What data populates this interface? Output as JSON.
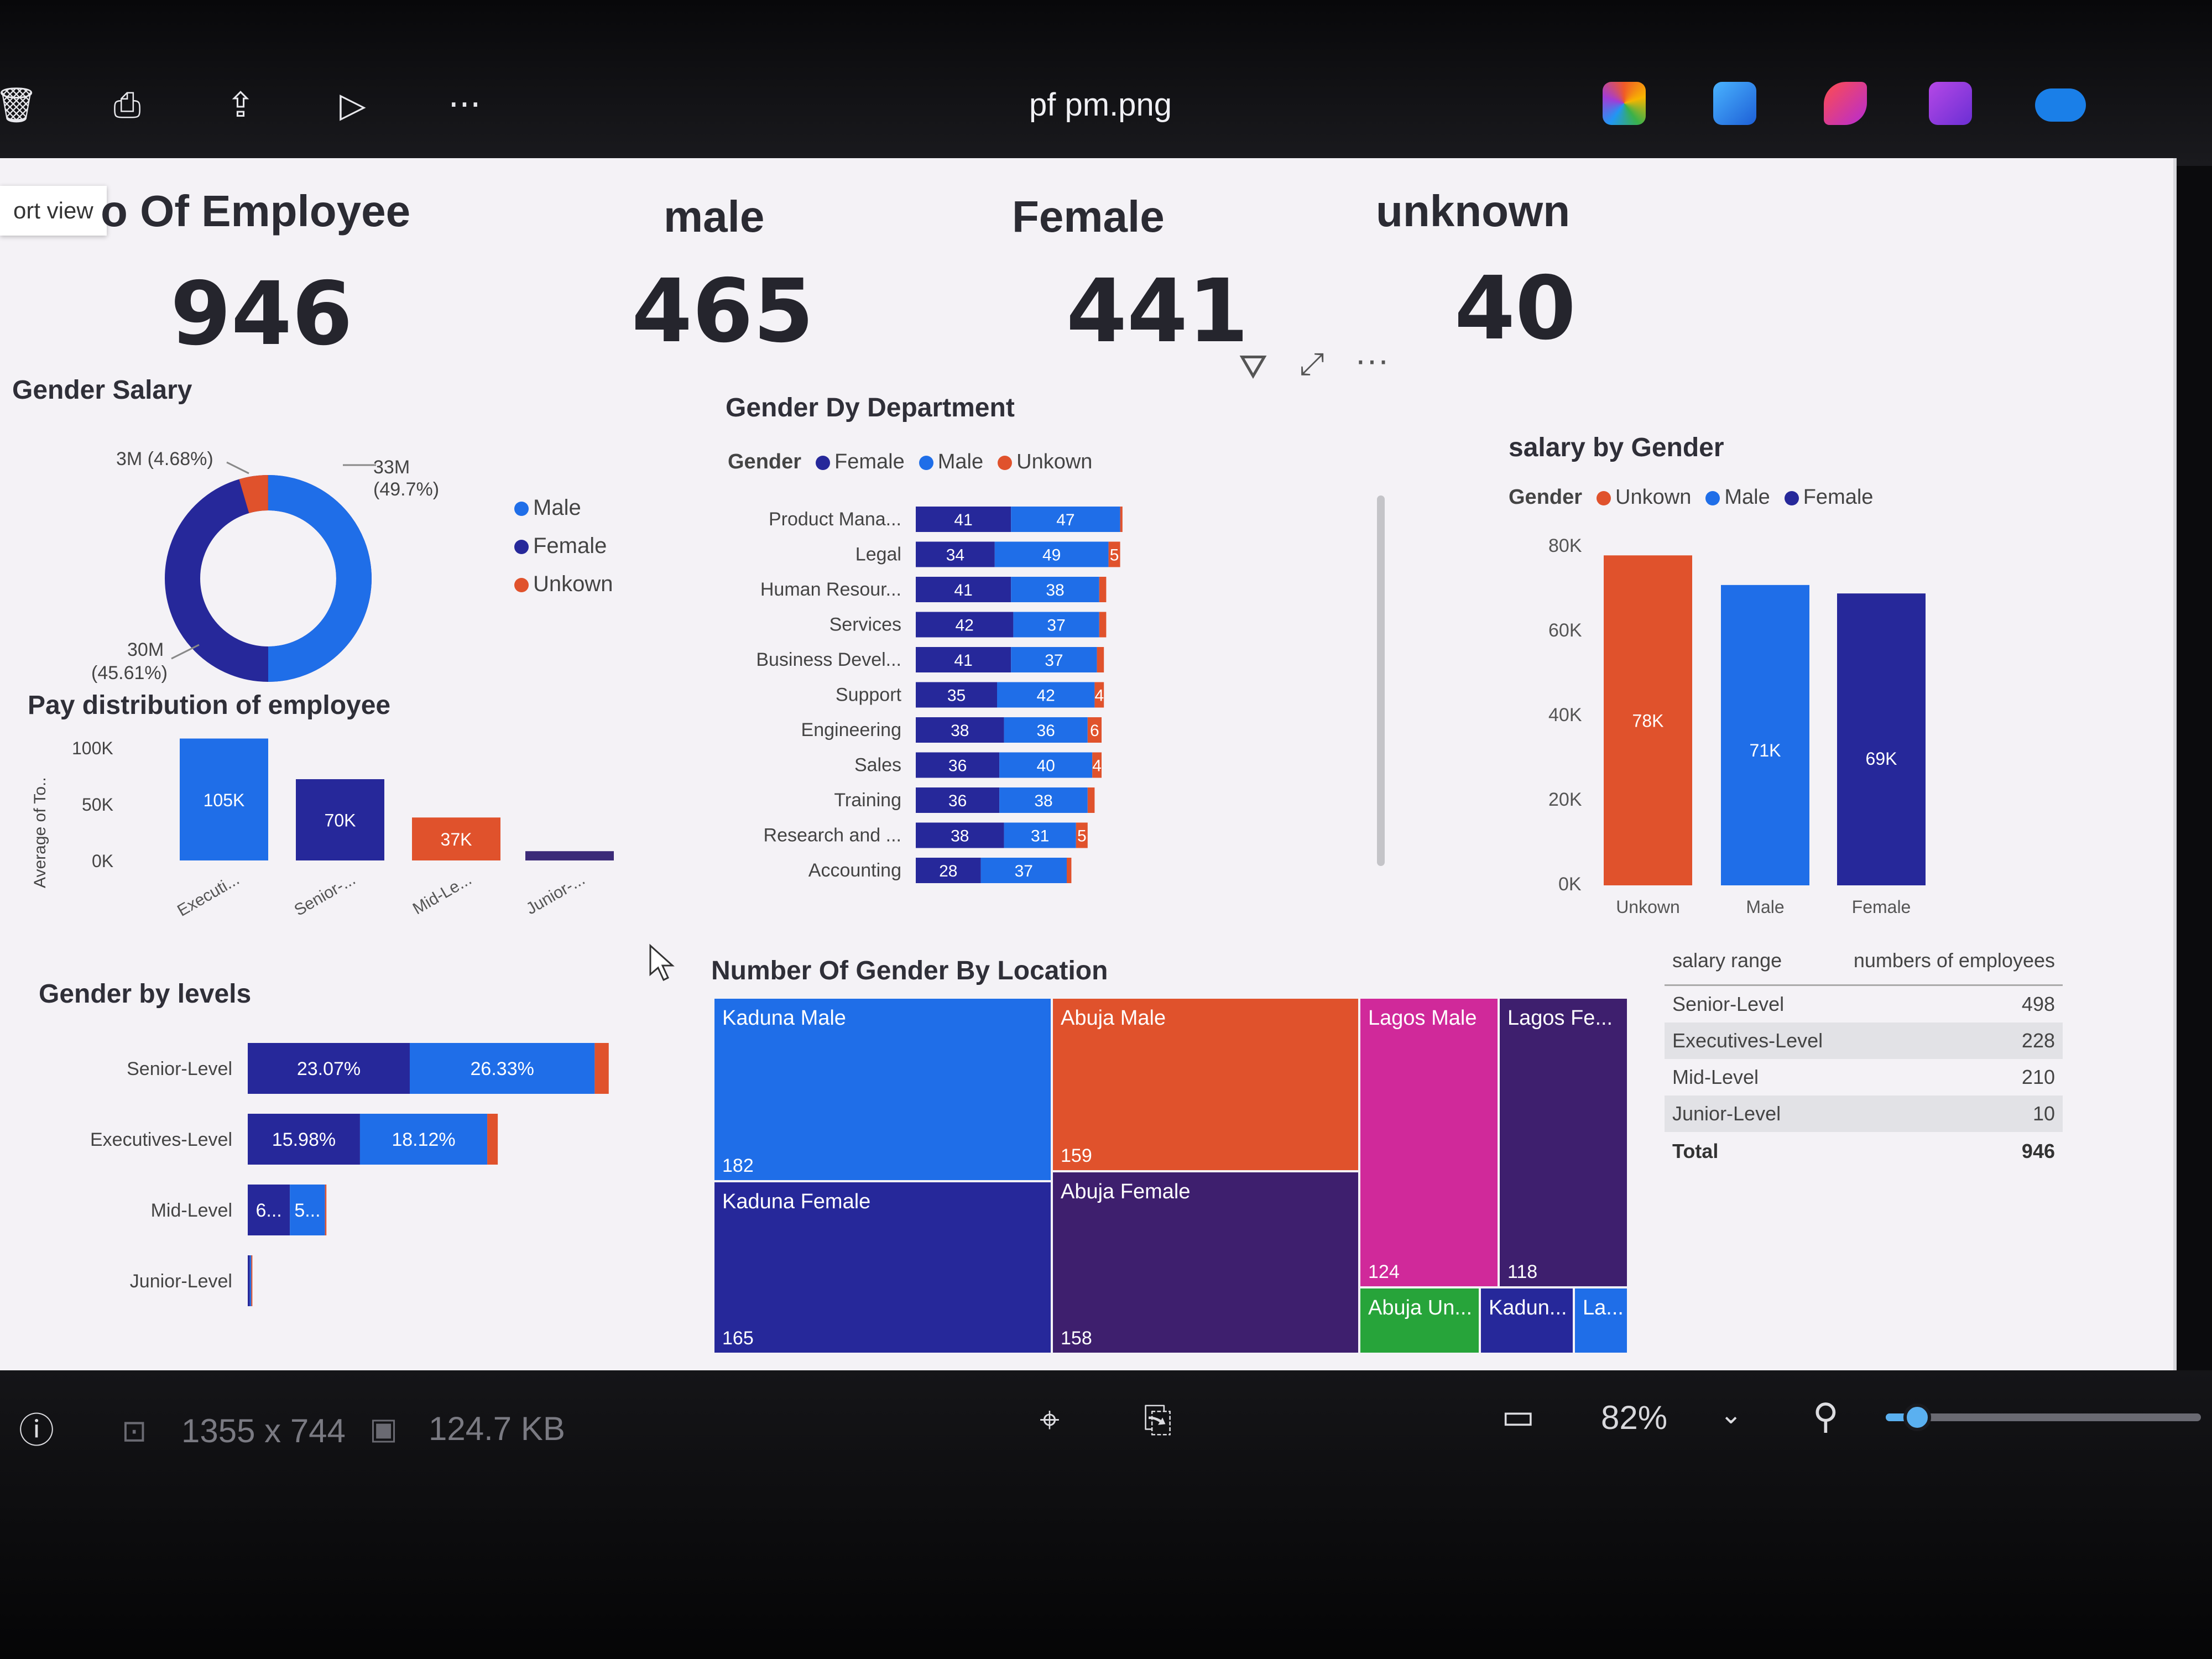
{
  "window": {
    "title": "pf pm.png",
    "toolbar_icons": [
      "delete-icon",
      "print-icon",
      "share-icon",
      "slideshow-icon",
      "more-icon"
    ],
    "app_icons": [
      "copilot-icon",
      "photos-icon",
      "clipchamp-icon",
      "designer-icon",
      "onedrive-icon"
    ]
  },
  "tooltip": {
    "text": "ort view"
  },
  "kpis": {
    "total": {
      "label": "o Of Employee",
      "value": "946"
    },
    "male": {
      "label": "male",
      "value": "465"
    },
    "female": {
      "label": "Female",
      "value": "441"
    },
    "unknown": {
      "label": "unknown",
      "value": "40"
    }
  },
  "visual_header_icons": [
    "filter-icon",
    "focus-mode-icon",
    "more-options-icon"
  ],
  "colors": {
    "male": "#1f6ee8",
    "female": "#26289a",
    "unknown": "#e0522c",
    "junior": "#3b2a78",
    "magenta": "#d0299a",
    "purple": "#3e1f6e",
    "green": "#27a43a"
  },
  "gender_salary": {
    "title": "Gender Salary",
    "labels": {
      "unknown": "3M (4.68%)",
      "male_top": "33M",
      "male_pct": "(49.7%)",
      "female_val": "30M",
      "female_pct": "(45.61%)"
    },
    "legend": [
      "Male",
      "Female",
      "Unkown"
    ]
  },
  "pay_distribution": {
    "title": "Pay distribution of employee",
    "y_title": "Average of To..",
    "y_ticks": [
      "100K",
      "50K",
      "0K"
    ]
  },
  "gender_by_department": {
    "title": "Gender Dy Department",
    "legend_title": "Gender",
    "legend": [
      "Female",
      "Male",
      "Unkown"
    ]
  },
  "salary_by_gender": {
    "title": "salary by Gender",
    "legend_title": "Gender",
    "legend": [
      "Unkown",
      "Male",
      "Female"
    ],
    "y_ticks": [
      "80K",
      "60K",
      "40K",
      "20K",
      "0K"
    ]
  },
  "gender_by_levels": {
    "title": "Gender by levels"
  },
  "location": {
    "title": "Number Of Gender By Location"
  },
  "salary_table": {
    "headers": [
      "salary range",
      "numbers of employees"
    ],
    "rows": [
      {
        "range": "Senior-Level",
        "count": "498"
      },
      {
        "range": "Executives-Level",
        "count": "228"
      },
      {
        "range": "Mid-Level",
        "count": "210"
      },
      {
        "range": "Junior-Level",
        "count": "10"
      }
    ],
    "total_label": "Total",
    "total_value": "946"
  },
  "status": {
    "dimensions": "1355 x 744",
    "file_size": "124.7 KB",
    "zoom": "82%",
    "zoom_level": 0.1
  },
  "chart_data": [
    {
      "type": "pie",
      "title": "Gender Salary",
      "categories": [
        "Male",
        "Female",
        "Unkown"
      ],
      "values": [
        33,
        30,
        3
      ],
      "percent": [
        49.7,
        45.61,
        4.68
      ],
      "unit": "M"
    },
    {
      "type": "bar",
      "title": "Pay distribution of employee",
      "ylabel": "Average of To..",
      "categories": [
        "Executi...",
        "Senior-...",
        "Mid-Le...",
        "Junior-..."
      ],
      "values": [
        105,
        70,
        37,
        8
      ],
      "labels": [
        "105K",
        "70K",
        "37K",
        ""
      ],
      "ylim": [
        0,
        100
      ]
    },
    {
      "type": "bar",
      "title": "Gender Dy Department",
      "categories": [
        "Product Mana...",
        "Legal",
        "Human Resour...",
        "Services",
        "Business Devel...",
        "Support",
        "Engineering",
        "Sales",
        "Training",
        "Research and ...",
        "Accounting"
      ],
      "series": [
        {
          "name": "Female",
          "values": [
            41,
            34,
            41,
            42,
            41,
            35,
            38,
            36,
            36,
            38,
            28
          ]
        },
        {
          "name": "Male",
          "values": [
            47,
            49,
            38,
            37,
            37,
            42,
            36,
            40,
            38,
            31,
            37
          ]
        },
        {
          "name": "Unkown",
          "values": [
            1,
            5,
            3,
            3,
            3,
            4,
            6,
            4,
            3,
            5,
            2
          ]
        }
      ]
    },
    {
      "type": "bar",
      "title": "salary by Gender",
      "categories": [
        "Unkown",
        "Male",
        "Female"
      ],
      "values": [
        78,
        71,
        69
      ],
      "labels": [
        "78K",
        "71K",
        "69K"
      ],
      "ylim": [
        0,
        80
      ]
    },
    {
      "type": "bar",
      "title": "Gender by levels",
      "categories": [
        "Senior-Level",
        "Executives-Level",
        "Mid-Level",
        "Junior-Level"
      ],
      "series": [
        {
          "name": "Female",
          "values": [
            23.07,
            15.98,
            6.0,
            0.3
          ],
          "labels": [
            "23.07%",
            "15.98%",
            "6...",
            ""
          ]
        },
        {
          "name": "Male",
          "values": [
            26.33,
            18.12,
            5.0,
            0.2
          ],
          "labels": [
            "26.33%",
            "18.12%",
            "5...",
            ""
          ]
        },
        {
          "name": "Unkown",
          "values": [
            2.0,
            1.5,
            0.2,
            0.1
          ],
          "labels": [
            "",
            "",
            "",
            ""
          ]
        }
      ]
    },
    {
      "type": "table",
      "title": "Number Of Gender By Location",
      "cells": [
        {
          "label": "Kaduna Male",
          "value": 182
        },
        {
          "label": "Kaduna Female",
          "value": 165
        },
        {
          "label": "Abuja Male",
          "value": 159
        },
        {
          "label": "Abuja Female",
          "value": 158
        },
        {
          "label": "Lagos Male",
          "value": 124
        },
        {
          "label": "Lagos Fe...",
          "value": 118
        },
        {
          "label": "Abuja Un...",
          "value": null
        },
        {
          "label": "Kadun...",
          "value": null
        },
        {
          "label": "La...",
          "value": null
        }
      ]
    }
  ]
}
